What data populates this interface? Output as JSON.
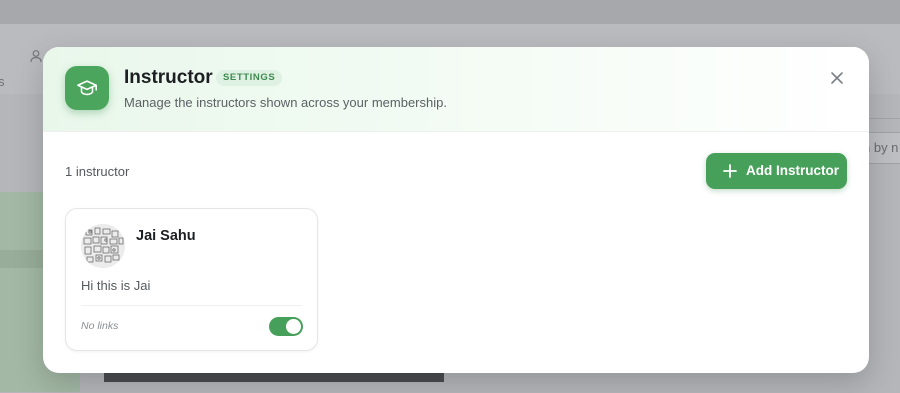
{
  "background": {
    "tab_fragment": "s",
    "search_fragment": "n by n"
  },
  "modal": {
    "title": "Instructor",
    "badge": "SETTINGS",
    "subtitle": "Manage the instructors shown across your membership.",
    "header_icon": "graduation-cap-icon",
    "close_icon": "close-icon",
    "accent_color": "#47a05a"
  },
  "toolbar": {
    "count_label": "1 instructor",
    "add_button_label": "Add Instructor",
    "add_button_icon": "plus-icon"
  },
  "instructors": [
    {
      "name": "Jai Sahu",
      "bio": "Hi this is Jai",
      "links_label": "No links",
      "enabled": true
    }
  ]
}
